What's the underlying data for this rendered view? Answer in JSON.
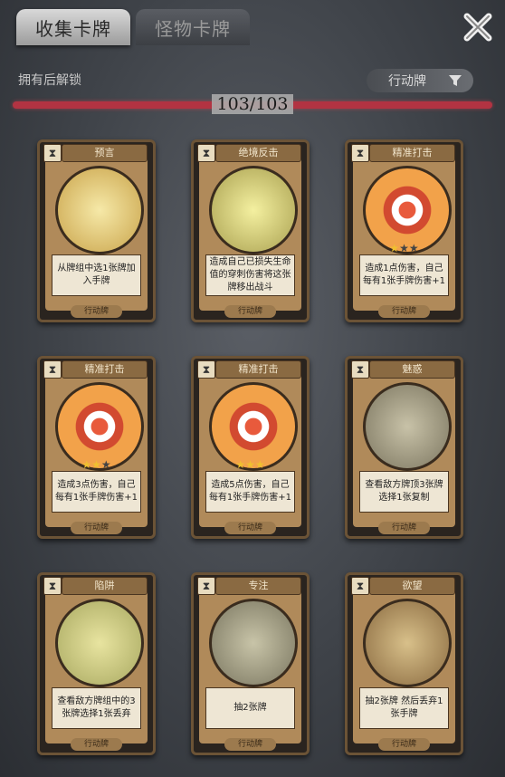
{
  "tabs": {
    "collection": "收集卡牌",
    "monster": "怪物卡牌"
  },
  "unlock_label": "拥有后解锁",
  "filter_label": "行动牌",
  "progress": {
    "text": "103/103",
    "value": 1.0
  },
  "cards": [
    {
      "title": "预言",
      "desc": "从牌组中选1张牌加入手牌",
      "foot": "行动牌",
      "stars": null
    },
    {
      "title": "绝境反击",
      "desc": "造成自己已损失生命值的穿刺伤害将这张牌移出战斗",
      "foot": "行动牌",
      "stars": null
    },
    {
      "title": "精准打击",
      "desc": "造成1点伤害，自己每有1张手牌伤害+1",
      "foot": "行动牌",
      "stars": 1
    },
    {
      "title": "精准打击",
      "desc": "造成3点伤害，自己每有1张手牌伤害+1",
      "foot": "行动牌",
      "stars": 2
    },
    {
      "title": "精准打击",
      "desc": "造成5点伤害，自己每有1张手牌伤害+1",
      "foot": "行动牌",
      "stars": 3
    },
    {
      "title": "魅惑",
      "desc": "查看敌方牌顶3张牌选择1张复制",
      "foot": "行动牌",
      "stars": null
    },
    {
      "title": "陷阱",
      "desc": "查看敌方牌组中的3张牌选择1张丢弃",
      "foot": "行动牌",
      "stars": null
    },
    {
      "title": "专注",
      "desc": "抽2张牌",
      "foot": "行动牌",
      "stars": null
    },
    {
      "title": "欲望",
      "desc": "抽2张牌 然后丢弃1张手牌",
      "foot": "行动牌",
      "stars": null
    }
  ],
  "colors": {
    "progress": "#b23342",
    "card_bg": "#2a241f",
    "star": "#f0c030"
  }
}
